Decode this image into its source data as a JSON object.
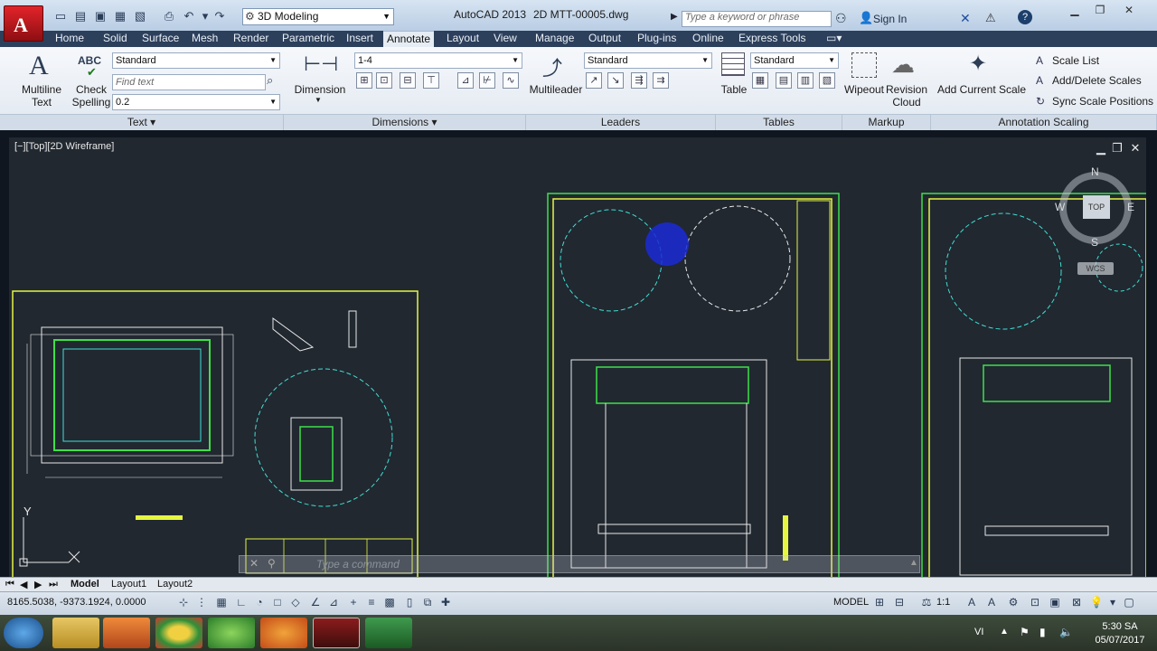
{
  "title_bar": {
    "app_title": "AutoCAD 2013",
    "file_title": "2D MTT-00005.dwg",
    "workspace": "3D Modeling",
    "search_placeholder": "Type a keyword or phrase",
    "sign_in": "Sign In"
  },
  "ribbon_tabs": [
    "Home",
    "Solid",
    "Surface",
    "Mesh",
    "Render",
    "Parametric",
    "Insert",
    "Annotate",
    "Layout",
    "View",
    "Manage",
    "Output",
    "Plug-ins",
    "Online",
    "Express Tools"
  ],
  "active_tab": "Annotate",
  "ribbon": {
    "text_panel": {
      "multiline_text_line1": "Multiline",
      "multiline_text_line2": "Text",
      "check_spelling_line1": "Check",
      "check_spelling_line2": "Spelling",
      "check_icon_text": "ABC",
      "text_style": "Standard",
      "find_placeholder": "Find text",
      "text_height": "0.2",
      "label": "Text"
    },
    "dimensions_panel": {
      "dimension_label": "Dimension",
      "dim_style": "1-4",
      "label": "Dimensions"
    },
    "leaders_panel": {
      "multileader_label": "Multileader",
      "leader_style": "Standard",
      "label": "Leaders"
    },
    "tables_panel": {
      "table_label": "Table",
      "table_style": "Standard",
      "label": "Tables"
    },
    "markup_panel": {
      "wipeout_label": "Wipeout",
      "revision_cloud_line1": "Revision",
      "revision_cloud_line2": "Cloud",
      "label": "Markup"
    },
    "annotation_scaling_panel": {
      "add_current_scale": "Add Current Scale",
      "scale_list": "Scale List",
      "add_delete_scales": "Add/Delete Scales",
      "sync_scale_positions": "Sync Scale Positions",
      "label": "Annotation Scaling"
    }
  },
  "viewport": {
    "label": "[−][Top][2D Wireframe]",
    "viewcube": {
      "north": "N",
      "south": "S",
      "east": "E",
      "west": "W",
      "top": "TOP",
      "wcs": "WCS"
    },
    "command_placeholder": "Type a command",
    "axis_y": "Y"
  },
  "layout_tabs": [
    "Model",
    "Layout1",
    "Layout2"
  ],
  "status_bar": {
    "coordinates": "8165.5038, -9373.1924, 0.0000",
    "model": "MODEL",
    "scale": "1:1"
  },
  "taskbar": {
    "language": "VI",
    "time": "5:30 SA",
    "date": "05/07/2017"
  },
  "colors": {
    "accent_tab": "#2c3f5b",
    "drawing_bg": "#212830",
    "cad_yellow": "#e5f542",
    "cad_cyan": "#3fe0d6",
    "cad_green": "#3ee04a",
    "cad_white": "#e8e8e8"
  }
}
